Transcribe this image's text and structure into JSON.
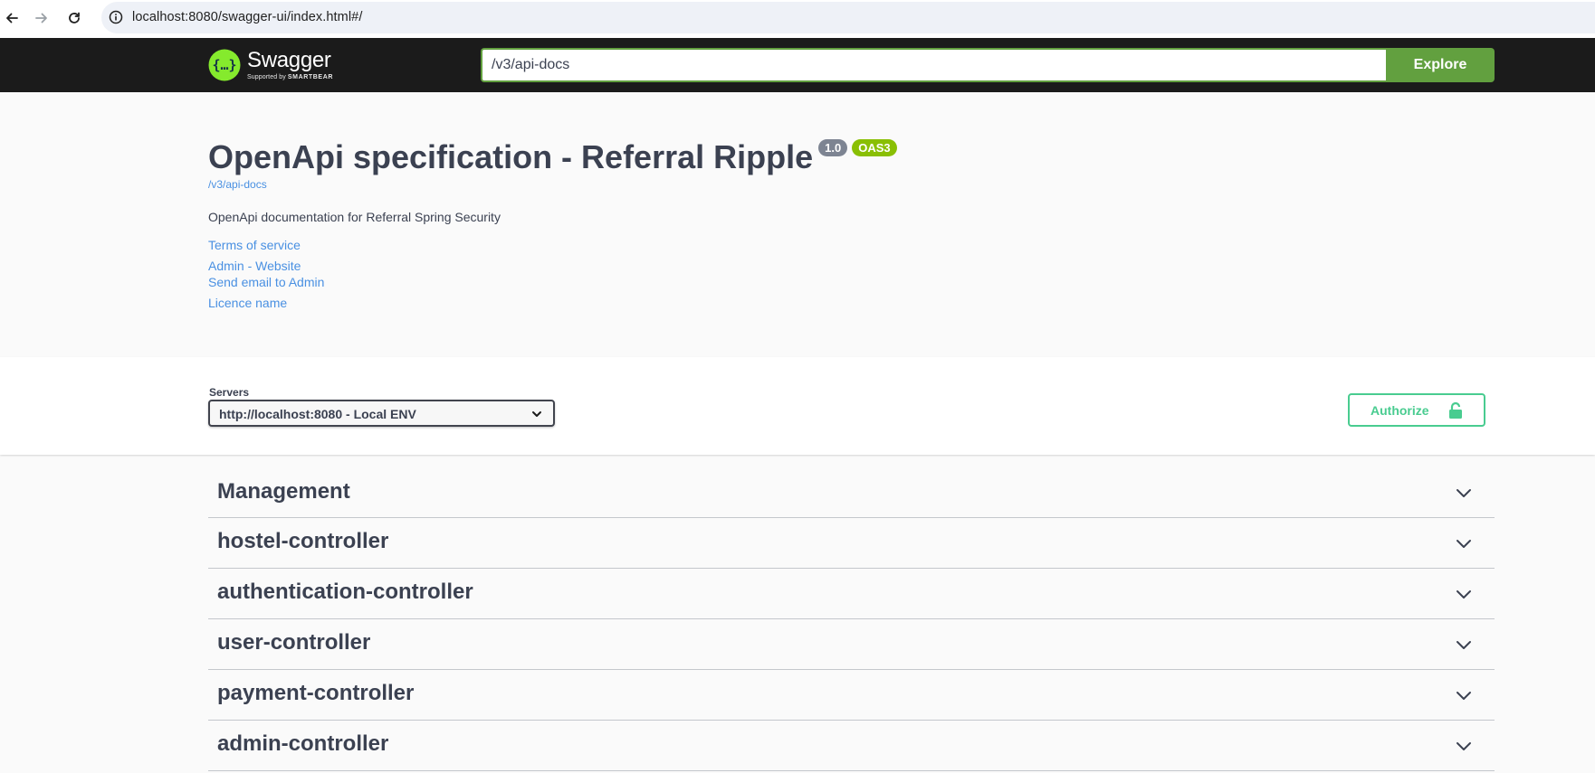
{
  "browser": {
    "url": "localhost:8080/swagger-ui/index.html#/",
    "icons": [
      "back-icon",
      "forward-icon",
      "reload-icon",
      "site-info-icon"
    ]
  },
  "topbar": {
    "logo_name": "Swagger",
    "logo_supported": "Supported by",
    "logo_brand": "SMARTBEAR",
    "explore_value": "/v3/api-docs",
    "explore_label": "Explore",
    "colors": {
      "bar": "#1b1b1b",
      "accent": "#62a03f"
    }
  },
  "info": {
    "title": "OpenApi specification - Referral Ripple",
    "version_badge": "1.0",
    "oas_badge": "OAS3",
    "docs_url": "/v3/api-docs",
    "description": "OpenApi documentation for Referral Spring Security",
    "links": {
      "terms": "Terms of service",
      "website": "Admin - Website",
      "email": "Send email to Admin",
      "licence": "Licence name"
    },
    "colors": {
      "link": "#4990e2",
      "version": "#7d8492",
      "oas": "#89bf04"
    }
  },
  "servers": {
    "label": "Servers",
    "selected": "http://localhost:8080 - Local ENV"
  },
  "authorize": {
    "label": "Authorize",
    "color": "#49cc90",
    "icon": "unlocked-lock-icon"
  },
  "tags": [
    {
      "name": "Management"
    },
    {
      "name": "hostel-controller"
    },
    {
      "name": "authentication-controller"
    },
    {
      "name": "user-controller"
    },
    {
      "name": "payment-controller"
    },
    {
      "name": "admin-controller"
    }
  ]
}
